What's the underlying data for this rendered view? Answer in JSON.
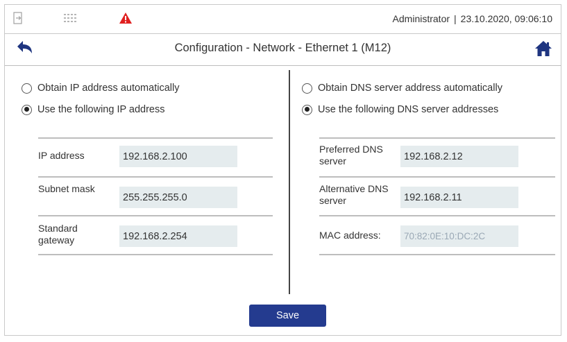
{
  "status": {
    "user": "Administrator",
    "separator": "|",
    "datetime": "23.10.2020, 09:06:10",
    "icons": [
      "login-icon",
      "keypad-icon",
      "warning-icon"
    ],
    "warning_color": "#e02020"
  },
  "header": {
    "title": "Configuration - Network - Ethernet 1 (M12)",
    "back_icon": "back-arrow-icon",
    "home_icon": "home-icon",
    "icon_color": "#1f3580"
  },
  "ip": {
    "auto_label": "Obtain IP address automatically",
    "manual_label": "Use the following IP address",
    "selected": "manual",
    "fields": [
      {
        "label": "IP address",
        "value": "192.168.2.100"
      },
      {
        "label": "Subnet mask",
        "value": "255.255.255.0"
      },
      {
        "label": "Standard gateway",
        "value": "192.168.2.254"
      }
    ]
  },
  "dns": {
    "auto_label": "Obtain DNS server address automatically",
    "manual_label": "Use the following DNS server addresses",
    "selected": "manual",
    "fields": [
      {
        "label": "Preferred DNS server",
        "value": "192.168.2.12"
      },
      {
        "label": "Alternative DNS server",
        "value": "192.168.2.11"
      }
    ],
    "mac_label": "MAC address:",
    "mac_value": "70:82:0E:10:DC:2C"
  },
  "actions": {
    "save_label": "Save",
    "save_color": "#243b8f"
  }
}
